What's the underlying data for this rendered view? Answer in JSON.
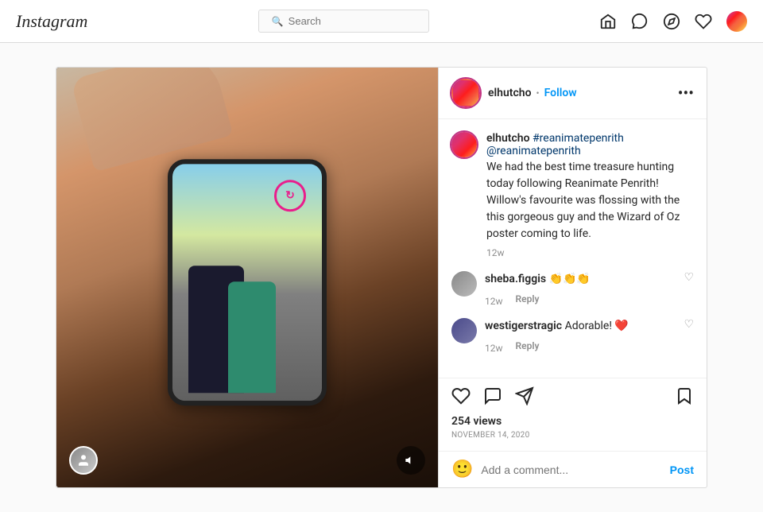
{
  "nav": {
    "logo": "Instagram",
    "search_placeholder": "Search",
    "icons": {
      "home": "🏠",
      "messenger": "💬",
      "compass": "🧭",
      "heart": "♡",
      "avatar_alt": "User avatar"
    }
  },
  "post": {
    "username": "elhutcho",
    "follow_label": "Follow",
    "more_icon": "•••",
    "main_comment": {
      "username": "elhutcho",
      "hashtag": "#reanimatepenrith",
      "mention": "@reanimatepenrith",
      "text": "We had the best time treasure hunting today following Reanimate Penrith! Willow's favourite was flossing with the this gorgeous guy and the Wizard of Oz poster coming to life.",
      "time": "12w"
    },
    "comments": [
      {
        "username": "sheba.figgis",
        "text": "👏👏👏",
        "time": "12w",
        "reply": "Reply"
      },
      {
        "username": "westigerstragic",
        "text": "Adorable! ❤️",
        "time": "12w",
        "reply": "Reply"
      }
    ],
    "views": "254 views",
    "date": "November 14, 2020",
    "comment_placeholder": "Add a comment...",
    "post_button": "Post",
    "sound_icon": "🔇",
    "person_icon": "👤"
  }
}
